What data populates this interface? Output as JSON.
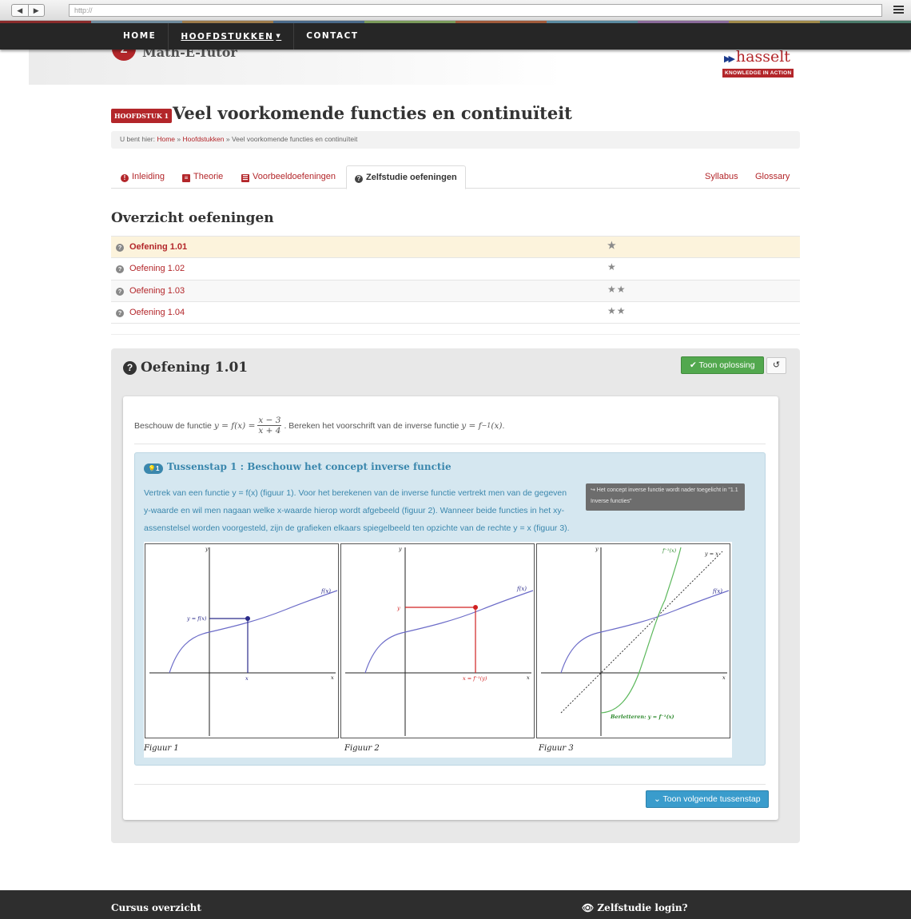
{
  "browser": {
    "url": "http://",
    "back": "◀",
    "forward": "▶"
  },
  "colors": {
    "accent": "#b3262a",
    "info": "#3a87ad",
    "success": "#52a84e",
    "nav_bg": "#262626"
  },
  "colorstrip": [
    "#8a2b2b",
    "#6e8a9c",
    "#9c7a4a",
    "#4a6a8a",
    "#7a9a5a",
    "#a05a3a",
    "#5a8aa0",
    "#8a6a9a",
    "#a08a4a",
    "#4a7a6a"
  ],
  "nav": {
    "home": "HOME",
    "chapters": "HOOFDSTUKKEN",
    "contact": "CONTACT"
  },
  "header": {
    "logo_mark": "Z",
    "logo_text": "Math-E-Tutor",
    "uni_arrows": "▶▶",
    "uni_name": "hasselt",
    "uni_tagline": "KNOWLEDGE IN ACTION"
  },
  "page": {
    "chapter_badge": "HOOFDSTUK 1",
    "title": "Veel voorkomende functies en continuïteit",
    "breadcrumb": {
      "prefix": "U bent hier:",
      "home": "Home",
      "sep1": "»",
      "chapters": "Hoofdstukken",
      "sep2": "»",
      "current": "Veel voorkomende functies en continuïteit"
    }
  },
  "tabs": {
    "intro": "Inleiding",
    "theory": "Theorie",
    "examples": "Voorbeeldoefeningen",
    "selfstudy": "Zelfstudie oefeningen",
    "syllabus": "Syllabus",
    "glossary": "Glossary"
  },
  "overview": {
    "title": "Overzicht oefeningen",
    "exercises": [
      {
        "label": "Oefening 1.01",
        "stars": "★"
      },
      {
        "label": "Oefening 1.02",
        "stars": "★"
      },
      {
        "label": "Oefening 1.03",
        "stars": "★★"
      },
      {
        "label": "Oefening 1.04",
        "stars": "★★"
      }
    ]
  },
  "exercise": {
    "title": "Oefening 1.01",
    "show_solution": "Toon oplossing",
    "reset_icon": "↺",
    "question": {
      "prefix": "Beschouw de functie",
      "lhs": "y = f(x) =",
      "num": "x − 3",
      "den": "x + 4",
      "middle": ". Bereken het voorschrift van de inverse functie",
      "rhs": "y = f",
      "sup": "−1",
      "rhs_end": "(x)",
      "suffix": "."
    },
    "step": {
      "badge": "💡1",
      "title": "Tussenstap 1 : Beschouw het concept inverse functie",
      "line1": "Vertrek van een functie y = f(x) (figuur 1). Voor het berekenen van de inverse functie vertrekt men van de gegeven",
      "line2": "y-waarde en wil men nagaan welke x-waarde hierop wordt afgebeeld (figuur 2). Wanneer beide functies in het xy-",
      "line3": "assenstelsel worden voorgesteld, zijn de grafieken elkaars spiegelbeeld ten opzichte van de rechte y = x (figuur 3).",
      "tooltip": "↪ Het concept inverse functie wordt nader toegelicht in \"1.1 Inverse functies\""
    },
    "figures": [
      {
        "caption": "Figuur 1",
        "label_curve": "f(x)",
        "label_y": "y = f(x)",
        "label_x": "x",
        "axis_x": "x",
        "axis_y": "y"
      },
      {
        "caption": "Figuur 2",
        "label_curve": "f(x)",
        "label_y": "y",
        "label_x": "x = f⁻¹(y)",
        "axis_x": "x",
        "axis_y": "y"
      },
      {
        "caption": "Figuur 3",
        "label_curve": "f(x)",
        "label_inverse": "f⁻¹(x)",
        "label_line": "y = x",
        "label_note": "Berletteren: y = f⁻¹(x)",
        "axis_x": "x",
        "axis_y": "y"
      }
    ],
    "next_step": "Toon volgende tussenstap"
  },
  "footer": {
    "left": "Cursus overzicht",
    "right": "Zelfstudie login?"
  }
}
